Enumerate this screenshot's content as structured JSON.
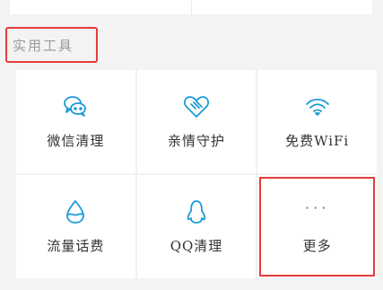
{
  "section": {
    "title": "实用工具"
  },
  "tools": [
    {
      "label": "微信清理",
      "icon": "wechat-icon"
    },
    {
      "label": "亲情守护",
      "icon": "heart-hands-icon"
    },
    {
      "label": "免费WiFi",
      "icon": "wifi-icon"
    },
    {
      "label": "流量话费",
      "icon": "water-drop-icon"
    },
    {
      "label": "QQ清理",
      "icon": "qq-penguin-icon"
    },
    {
      "label": "更多",
      "icon": "more-dots-icon"
    }
  ],
  "more_dots": "···",
  "colors": {
    "accent": "#1a9bd7",
    "highlight_border": "#e43b3b",
    "section_text": "#9a9a9a",
    "label_text": "#333333"
  }
}
